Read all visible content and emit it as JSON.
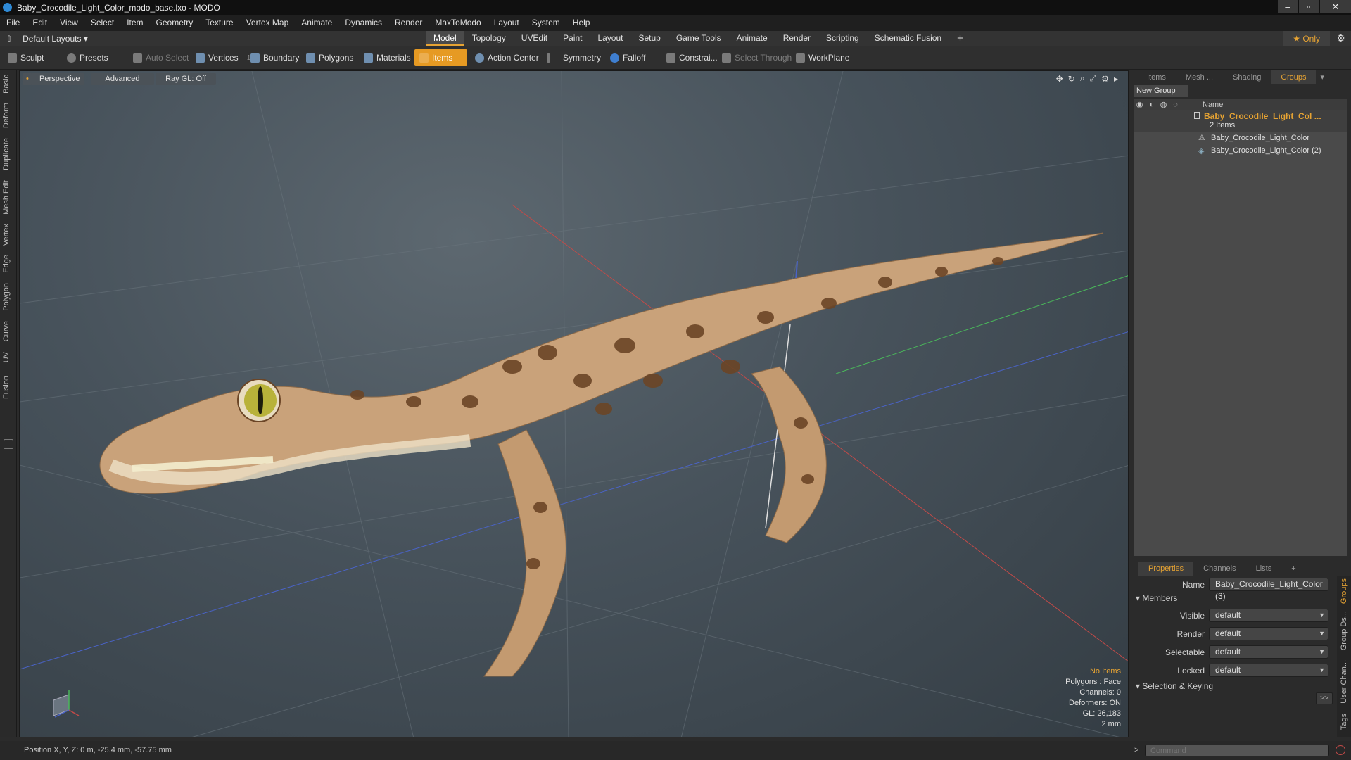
{
  "window": {
    "title": "Baby_Crocodile_Light_Color_modo_base.lxo - MODO",
    "buttons": [
      "–",
      "▫",
      "✕"
    ]
  },
  "menu": [
    "File",
    "Edit",
    "View",
    "Select",
    "Item",
    "Geometry",
    "Texture",
    "Vertex Map",
    "Animate",
    "Dynamics",
    "Render",
    "MaxToModo",
    "Layout",
    "System",
    "Help"
  ],
  "layoutbar": {
    "preset": "Default Layouts ▾",
    "tabs": [
      "Model",
      "Topology",
      "UVEdit",
      "Paint",
      "Layout",
      "Setup",
      "Game Tools",
      "Animate",
      "Render",
      "Scripting",
      "Schematic Fusion"
    ],
    "active_tab": "Model",
    "add": "+",
    "only_label": "★  Only",
    "settings_icon": "gear-icon"
  },
  "toolbar": {
    "sculpt": "Sculpt",
    "presets": "Presets",
    "auto_select": "Auto Select",
    "vertices": "Vertices",
    "vertices_count": "1",
    "boundary": "Boundary",
    "polygons": "Polygons",
    "materials": "Materials",
    "items": "Items",
    "action_center": "Action Center",
    "symmetry": "Symmetry",
    "falloff": "Falloff",
    "constrain": "Constrai...",
    "select_through": "Select Through",
    "workplane": "WorkPlane"
  },
  "left_tabs": [
    "Basic",
    "Deform",
    "Duplicate",
    "Mesh Edit",
    "Vertex",
    "Edge",
    "Polygon",
    "Curve",
    "UV",
    "Fusion"
  ],
  "viewport": {
    "view_mode": "Perspective",
    "shading": "Advanced",
    "raygl": "Ray GL: Off",
    "info": {
      "items": "No Items",
      "polygons": "Polygons : Face",
      "channels": "Channels: 0",
      "deformers": "Deformers: ON",
      "gl": "GL: 26,183",
      "scale": "2 mm"
    },
    "colors": {
      "accent": "#e6a333",
      "info_highlight": "#e6a333"
    }
  },
  "groups_panel": {
    "tabs": [
      "Items",
      "Mesh ...",
      "Shading",
      "Groups"
    ],
    "active_tab": "Groups",
    "new_group": "New Group",
    "col_name": "Name",
    "group_name": "Baby_Crocodile_Light_Col ...",
    "group_count": "2 Items",
    "children": [
      "Baby_Crocodile_Light_Color",
      "Baby_Crocodile_Light_Color (2)"
    ]
  },
  "properties_panel": {
    "tabs": [
      "Properties",
      "Channels",
      "Lists",
      "+"
    ],
    "active_tab": "Properties",
    "name_label": "Name",
    "name_value": "Baby_Crocodile_Light_Color (3)",
    "members": "Members",
    "rows": [
      {
        "label": "Visible",
        "value": "default"
      },
      {
        "label": "Render",
        "value": "default"
      },
      {
        "label": "Selectable",
        "value": "default"
      },
      {
        "label": "Locked",
        "value": "default"
      }
    ],
    "selection_keying": "Selection & Keying",
    "more": ">>",
    "side_tabs": [
      "Groups",
      "Group Ds...",
      "User Chan...",
      "Tags"
    ]
  },
  "statusbar": {
    "position": "Position X, Y, Z:  0 m, -25.4 mm, -57.75 mm",
    "command_prompt": ">",
    "command_placeholder": "Command"
  }
}
